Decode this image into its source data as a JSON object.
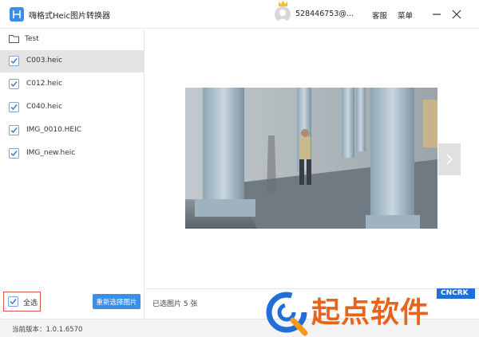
{
  "titlebar": {
    "app_title": "嗨格式Heic图片转换器",
    "user_id": "528446753@...",
    "nav_service": "客服",
    "nav_menu": "菜单"
  },
  "folder": {
    "name": "Test"
  },
  "files": [
    {
      "name": "C003.heic",
      "checked": true,
      "selected": true
    },
    {
      "name": "C012.heic",
      "checked": true,
      "selected": false
    },
    {
      "name": "C040.heic",
      "checked": true,
      "selected": false
    },
    {
      "name": "IMG_0010.HEIC",
      "checked": true,
      "selected": false
    },
    {
      "name": "IMG_new.heic",
      "checked": true,
      "selected": false
    }
  ],
  "bottom": {
    "select_all_label": "全选",
    "reselect_label": "重新选择图片",
    "selected_count": "已选图片 5 张"
  },
  "status": {
    "version": "当前版本：1.0.1.6570"
  },
  "watermark": {
    "brand": "起点软件",
    "tag": "CNCRK"
  },
  "colors": {
    "accent": "#3a8ee6",
    "select_all_border": "#d9534f",
    "watermark_blue": "#1f6fd6",
    "watermark_orange": "#f39a1c"
  }
}
